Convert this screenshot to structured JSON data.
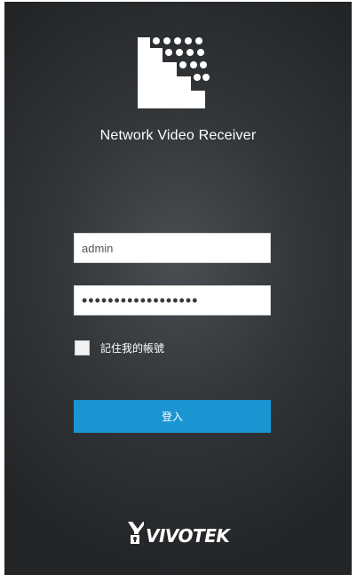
{
  "app": {
    "title": "Network Video Receiver",
    "logo_icon": "nvr-grid-logo-icon"
  },
  "login": {
    "username_value": "admin",
    "password_value": "••••••••••••••••••",
    "remember_label": "記住我的帳號",
    "remember_checked": false,
    "submit_label": "登入"
  },
  "brand": {
    "name": "VIVOTEK"
  },
  "colors": {
    "background": "#2e3033",
    "accent": "#1b94d2",
    "text": "#ffffff"
  }
}
